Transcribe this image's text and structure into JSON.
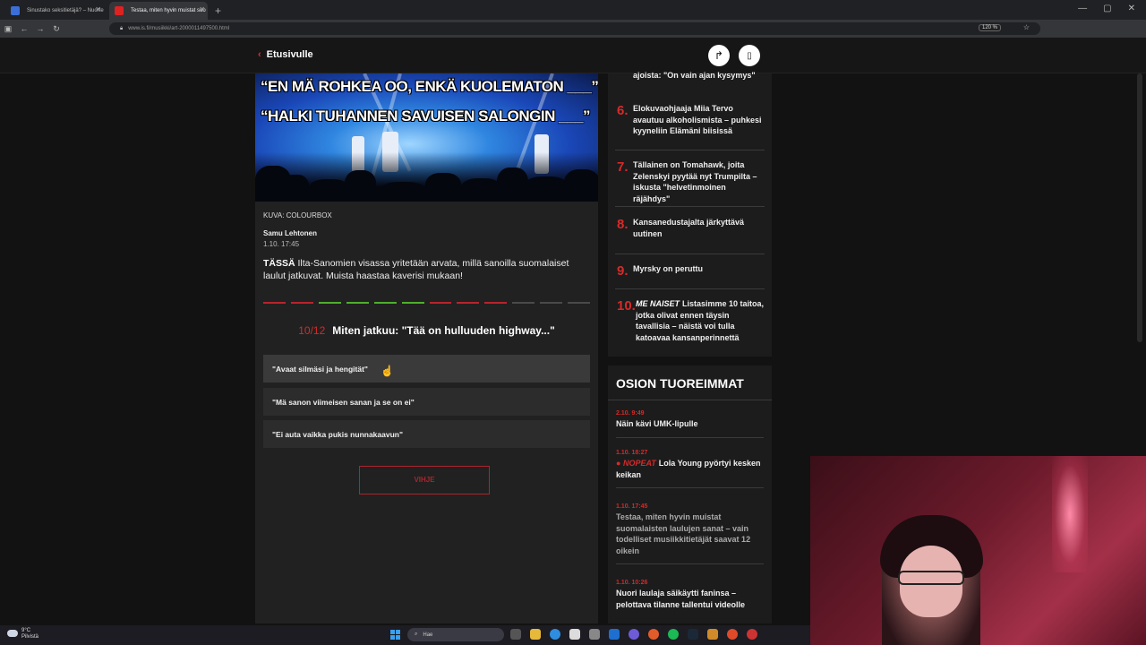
{
  "browser": {
    "tabs": [
      {
        "title": "Sinustako seksitietäjä? – Nuorte"
      },
      {
        "title": "Testaa, miten hyvin muistat suo"
      }
    ],
    "url": "www.is.fi/musiikki/art-2000011497500.html",
    "zoom": "120 %"
  },
  "header": {
    "back_label": "Etusivulle"
  },
  "article": {
    "hero_line1": "“EN MÄ ROHKEA OO, ENKÄ KUOLEMATON ___”",
    "hero_line2": "“HALKI TUHANNEN SAVUISEN SALONGIN ___”",
    "caption": "KUVA: COLOURBOX",
    "author": "Samu Lehtonen",
    "date": "1.10. 17:45",
    "lead_bold": "TÄSSÄ",
    "lead_text": " Ilta-Sanomien visassa yritetään arvata, millä sanoilla suomalaiset laulut jatkuvat. Muista haastaa kaverisi mukaan!",
    "progress": [
      "wrong",
      "wrong",
      "right",
      "right",
      "right",
      "right",
      "wrong",
      "wrong",
      "wrong",
      "none",
      "none",
      "none"
    ],
    "progress_colors": {
      "wrong": "#b8252d",
      "right": "#4fae2c",
      "none": "#4a4a4a"
    },
    "question_number": "10/12",
    "question_text": "Miten jatkuu: \"Tää on hulluuden highway...\"",
    "answers": [
      "\"Avaat silmäsi ja hengität\"",
      "\"Mä sanon viimeisen sanan ja se on ei\"",
      "\"Ei auta vaikka pukis nunnakaavun\""
    ],
    "hint_label": "VIHJE"
  },
  "sidebar": {
    "partial_top": "ajoista: \"On vain ajan kysymys\"",
    "items": [
      {
        "rank": "6.",
        "text": "Elokuvaohjaaja Miia Tervo avautuu alkoholismista – puhkesi kyyneliin Elämäni biisissä"
      },
      {
        "rank": "7.",
        "text": "Tällainen on Tomahawk, joita Zelenskyi pyytää nyt Trumpilta – iskusta \"helvetinmoinen räjähdys\""
      },
      {
        "rank": "8.",
        "text": "Kansanedustajalta järkyttävä uutinen"
      },
      {
        "rank": "9.",
        "text": "Myrsky on peruttu"
      },
      {
        "rank": "10.",
        "tag": "ME NAISET",
        "text": "Listasimme 10 taitoa, jotka olivat ennen täysin tavallisia – näistä voi tulla katoavaa kansan­perinnettä"
      }
    ],
    "latest_title": "OSION TUOREIMMAT",
    "latest": [
      {
        "time": "2.10. 9:49",
        "text": "Näin kävi UMK-lipulle"
      },
      {
        "time": "1.10. 18:27",
        "badge": "NOPEAT",
        "text": "Lola Young pyörtyi kesken keikan"
      },
      {
        "time": "1.10. 17:45",
        "text": "Testaa, miten hyvin muistat suomalaisten laulujen sanat – vain todelliset musiikkitietäjät saavat 12 oikein"
      },
      {
        "time": "1.10. 10:26",
        "text": "Nuori laulaja säikäytti faninsa – pelottava tilanne tallentui videolle"
      }
    ]
  },
  "taskbar": {
    "weather_temp": "9°C",
    "weather_text": "Pilvistä",
    "search_placeholder": "Hae"
  }
}
